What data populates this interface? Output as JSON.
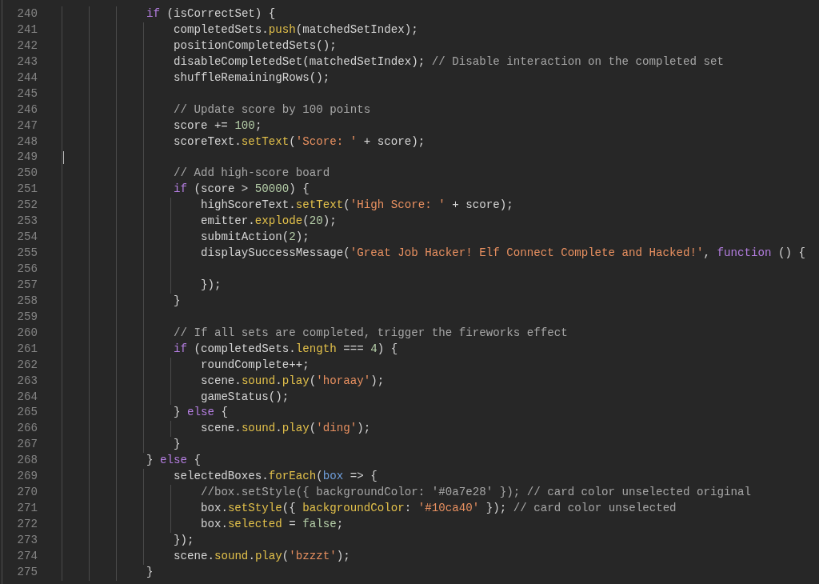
{
  "editor": {
    "lines": [
      {
        "number": "240",
        "cursor": false,
        "tokens": [
          {
            "kind": "keyword",
            "text": "                if"
          },
          {
            "kind": "plain",
            "text": " (isCorrectSet) {"
          }
        ]
      },
      {
        "number": "241",
        "cursor": false,
        "tokens": [
          {
            "kind": "plain",
            "text": "                    completedSets."
          },
          {
            "kind": "method",
            "text": "push"
          },
          {
            "kind": "plain",
            "text": "(matchedSetIndex);"
          }
        ]
      },
      {
        "number": "242",
        "cursor": false,
        "tokens": [
          {
            "kind": "plain",
            "text": "                    positionCompletedSets();"
          }
        ]
      },
      {
        "number": "243",
        "cursor": false,
        "tokens": [
          {
            "kind": "plain",
            "text": "                    disableCompletedSet(matchedSetIndex); "
          },
          {
            "kind": "comment",
            "text": "// Disable interaction on the completed set"
          }
        ]
      },
      {
        "number": "244",
        "cursor": false,
        "tokens": [
          {
            "kind": "plain",
            "text": "                    shuffleRemainingRows();"
          }
        ]
      },
      {
        "number": "245",
        "cursor": false
      },
      {
        "number": "246",
        "cursor": false,
        "tokens": [
          {
            "kind": "comment",
            "text": "                    // Update score by 100 points"
          }
        ]
      },
      {
        "number": "247",
        "cursor": false,
        "tokens": [
          {
            "kind": "plain",
            "text": "                    score += "
          },
          {
            "kind": "number",
            "text": "100"
          },
          {
            "kind": "plain",
            "text": ";"
          }
        ]
      },
      {
        "number": "248",
        "cursor": false,
        "tokens": [
          {
            "kind": "plain",
            "text": "                    scoreText."
          },
          {
            "kind": "method",
            "text": "setText"
          },
          {
            "kind": "plain",
            "text": "("
          },
          {
            "kind": "string",
            "text": "'Score: '"
          },
          {
            "kind": "plain",
            "text": " + score);"
          }
        ]
      },
      {
        "number": "249",
        "cursor": true
      },
      {
        "number": "250",
        "cursor": false,
        "tokens": [
          {
            "kind": "comment",
            "text": "                    // Add high-score board"
          }
        ]
      },
      {
        "number": "251",
        "cursor": false,
        "tokens": [
          {
            "kind": "keyword",
            "text": "                    if"
          },
          {
            "kind": "plain",
            "text": " (score > "
          },
          {
            "kind": "number",
            "text": "50000"
          },
          {
            "kind": "plain",
            "text": ") {"
          }
        ]
      },
      {
        "number": "252",
        "cursor": false,
        "tokens": [
          {
            "kind": "plain",
            "text": "                        highScoreText."
          },
          {
            "kind": "method",
            "text": "setText"
          },
          {
            "kind": "plain",
            "text": "("
          },
          {
            "kind": "string",
            "text": "'High Score: '"
          },
          {
            "kind": "plain",
            "text": " + score);"
          }
        ]
      },
      {
        "number": "253",
        "cursor": false,
        "tokens": [
          {
            "kind": "plain",
            "text": "                        emitter."
          },
          {
            "kind": "method",
            "text": "explode"
          },
          {
            "kind": "plain",
            "text": "("
          },
          {
            "kind": "number",
            "text": "20"
          },
          {
            "kind": "plain",
            "text": ");"
          }
        ]
      },
      {
        "number": "254",
        "cursor": false,
        "tokens": [
          {
            "kind": "plain",
            "text": "                        submitAction("
          },
          {
            "kind": "number",
            "text": "2"
          },
          {
            "kind": "plain",
            "text": ");"
          }
        ]
      },
      {
        "number": "255",
        "cursor": false,
        "tokens": [
          {
            "kind": "plain",
            "text": "                        displaySuccessMessage("
          },
          {
            "kind": "string",
            "text": "'Great Job Hacker! Elf Connect Complete and Hacked!'"
          },
          {
            "kind": "plain",
            "text": ", "
          },
          {
            "kind": "keyword",
            "text": "function"
          },
          {
            "kind": "plain",
            "text": " () {"
          }
        ]
      },
      {
        "number": "256",
        "cursor": false
      },
      {
        "number": "257",
        "cursor": false,
        "tokens": [
          {
            "kind": "plain",
            "text": "                        });"
          }
        ]
      },
      {
        "number": "258",
        "cursor": false,
        "tokens": [
          {
            "kind": "plain",
            "text": "                    }"
          }
        ]
      },
      {
        "number": "259",
        "cursor": false
      },
      {
        "number": "260",
        "cursor": false,
        "tokens": [
          {
            "kind": "comment",
            "text": "                    // If all sets are completed, trigger the fireworks effect"
          }
        ]
      },
      {
        "number": "261",
        "cursor": false,
        "tokens": [
          {
            "kind": "keyword",
            "text": "                    if"
          },
          {
            "kind": "plain",
            "text": " (completedSets."
          },
          {
            "kind": "method",
            "text": "length"
          },
          {
            "kind": "plain",
            "text": " === "
          },
          {
            "kind": "number",
            "text": "4"
          },
          {
            "kind": "plain",
            "text": ") {"
          }
        ]
      },
      {
        "number": "262",
        "cursor": false,
        "tokens": [
          {
            "kind": "plain",
            "text": "                        roundComplete++;"
          }
        ]
      },
      {
        "number": "263",
        "cursor": false,
        "tokens": [
          {
            "kind": "plain",
            "text": "                        scene."
          },
          {
            "kind": "method",
            "text": "sound"
          },
          {
            "kind": "plain",
            "text": "."
          },
          {
            "kind": "method",
            "text": "play"
          },
          {
            "kind": "plain",
            "text": "("
          },
          {
            "kind": "string",
            "text": "'horaay'"
          },
          {
            "kind": "plain",
            "text": ");"
          }
        ]
      },
      {
        "number": "264",
        "cursor": false,
        "tokens": [
          {
            "kind": "plain",
            "text": "                        gameStatus();"
          }
        ]
      },
      {
        "number": "265",
        "cursor": false,
        "tokens": [
          {
            "kind": "plain",
            "text": "                    } "
          },
          {
            "kind": "keyword",
            "text": "else"
          },
          {
            "kind": "plain",
            "text": " {"
          }
        ]
      },
      {
        "number": "266",
        "cursor": false,
        "tokens": [
          {
            "kind": "plain",
            "text": "                        scene."
          },
          {
            "kind": "method",
            "text": "sound"
          },
          {
            "kind": "plain",
            "text": "."
          },
          {
            "kind": "method",
            "text": "play"
          },
          {
            "kind": "plain",
            "text": "("
          },
          {
            "kind": "string",
            "text": "'ding'"
          },
          {
            "kind": "plain",
            "text": ");"
          }
        ]
      },
      {
        "number": "267",
        "cursor": false,
        "tokens": [
          {
            "kind": "plain",
            "text": "                    }"
          }
        ]
      },
      {
        "number": "268",
        "cursor": false,
        "tokens": [
          {
            "kind": "plain",
            "text": "                } "
          },
          {
            "kind": "keyword",
            "text": "else"
          },
          {
            "kind": "plain",
            "text": " {"
          }
        ]
      },
      {
        "number": "269",
        "cursor": false,
        "tokens": [
          {
            "kind": "plain",
            "text": "                    selectedBoxes."
          },
          {
            "kind": "method",
            "text": "forEach"
          },
          {
            "kind": "plain",
            "text": "("
          },
          {
            "kind": "param",
            "text": "box"
          },
          {
            "kind": "plain",
            "text": " => {"
          }
        ]
      },
      {
        "number": "270",
        "cursor": false,
        "tokens": [
          {
            "kind": "comment",
            "text": "                        //box.setStyle({ backgroundColor: '#0a7e28' }); // card color unselected original"
          }
        ]
      },
      {
        "number": "271",
        "cursor": false,
        "tokens": [
          {
            "kind": "plain",
            "text": "                        box."
          },
          {
            "kind": "method",
            "text": "setStyle"
          },
          {
            "kind": "plain",
            "text": "({ "
          },
          {
            "kind": "method",
            "text": "backgroundColor"
          },
          {
            "kind": "plain",
            "text": ": "
          },
          {
            "kind": "string",
            "text": "'#10ca40'"
          },
          {
            "kind": "plain",
            "text": " }); "
          },
          {
            "kind": "comment",
            "text": "// card color unselected"
          }
        ]
      },
      {
        "number": "272",
        "cursor": false,
        "tokens": [
          {
            "kind": "plain",
            "text": "                        box."
          },
          {
            "kind": "method",
            "text": "selected"
          },
          {
            "kind": "plain",
            "text": " = "
          },
          {
            "kind": "constant",
            "text": "false"
          },
          {
            "kind": "plain",
            "text": ";"
          }
        ]
      },
      {
        "number": "273",
        "cursor": false,
        "tokens": [
          {
            "kind": "plain",
            "text": "                    });"
          }
        ]
      },
      {
        "number": "274",
        "cursor": false,
        "tokens": [
          {
            "kind": "plain",
            "text": "                    scene."
          },
          {
            "kind": "method",
            "text": "sound"
          },
          {
            "kind": "plain",
            "text": "."
          },
          {
            "kind": "method",
            "text": "play"
          },
          {
            "kind": "plain",
            "text": "("
          },
          {
            "kind": "string",
            "text": "'bzzzt'"
          },
          {
            "kind": "plain",
            "text": ");"
          }
        ]
      },
      {
        "number": "275",
        "cursor": false,
        "tokens": [
          {
            "kind": "plain",
            "text": "                }"
          }
        ]
      }
    ]
  }
}
